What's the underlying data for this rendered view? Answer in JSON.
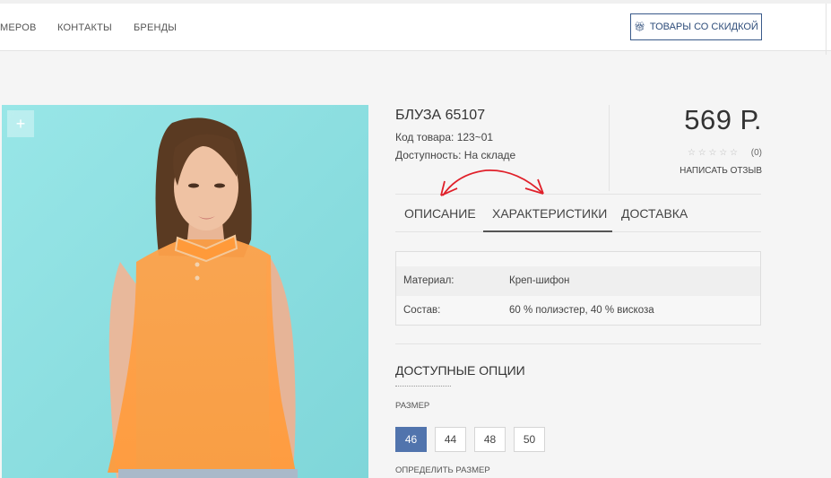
{
  "nav": {
    "items": [
      "МЕРОВ",
      "КОНТАКТЫ",
      "БРЕНДЫ"
    ],
    "discount_button": "ТОВАРЫ СО СКИДКОЙ"
  },
  "gallery": {
    "zoom_symbol": "+"
  },
  "product": {
    "title": "БЛУЗА 65107",
    "code": "Код товара: 123~01",
    "availability": "Доступность: На складе",
    "price": "569 Р.",
    "rating_count": "(0)",
    "write_review": "НАПИСАТЬ ОТЗЫВ"
  },
  "tabs": [
    "ОПИСАНИЕ",
    "ХАРАКТЕРИСТИКИ",
    "ДОСТАВКА"
  ],
  "specs": [
    {
      "key": "Материал:",
      "value": "Креп-шифон"
    },
    {
      "key": "Состав:",
      "value": "60 % полиэстер, 40 % вискоза"
    }
  ],
  "options": {
    "title": "ДОСТУПНЫЕ ОПЦИИ",
    "size_label": "РАЗМЕР",
    "sizes": [
      "46",
      "44",
      "48",
      "50"
    ],
    "selected_size": "46",
    "size_guide": "ОПРЕДЕЛИТЬ РАЗМЕР"
  },
  "colors": {
    "accent": "#5174ad",
    "photo_bg": "#8fe3e4",
    "annotation": "#e0202a"
  }
}
